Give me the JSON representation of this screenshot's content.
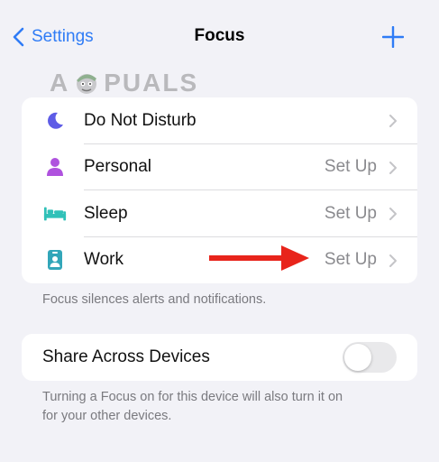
{
  "nav": {
    "back_label": "Settings",
    "title": "Focus"
  },
  "watermark": {
    "text_left": "A",
    "text_right": "PUALS"
  },
  "focus_modes": [
    {
      "label": "Do Not Disturb",
      "value": "",
      "icon": "moon-icon",
      "color": "#5e5ce6"
    },
    {
      "label": "Personal",
      "value": "Set Up",
      "icon": "person-icon",
      "color": "#af52de"
    },
    {
      "label": "Sleep",
      "value": "Set Up",
      "icon": "bed-icon",
      "color": "#30c1b8"
    },
    {
      "label": "Work",
      "value": "Set Up",
      "icon": "badge-icon",
      "color": "#32a6b9"
    }
  ],
  "focus_footer": "Focus silences alerts and notifications.",
  "share": {
    "label": "Share Across Devices",
    "enabled": false,
    "footer_line1": "Turning a Focus on for this device will also turn it on",
    "footer_line2": "for your other devices."
  },
  "colors": {
    "accent": "#2f7cf6",
    "annotation_arrow": "#e8241b"
  }
}
